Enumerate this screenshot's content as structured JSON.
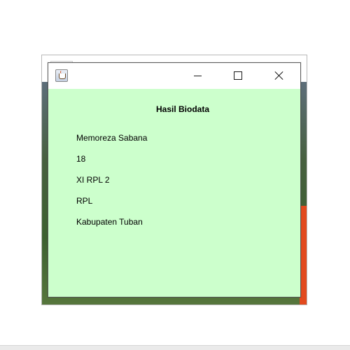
{
  "window": {
    "title": "",
    "icon": "java-cup-icon"
  },
  "content": {
    "heading": "Hasil Biodata",
    "fields": [
      "Memoreza Sabana",
      "18",
      "XI RPL 2",
      "RPL",
      "Kabupaten Tuban"
    ]
  },
  "colors": {
    "panel_background": "#ccffcc",
    "title_bar_background": "#ffffff"
  }
}
